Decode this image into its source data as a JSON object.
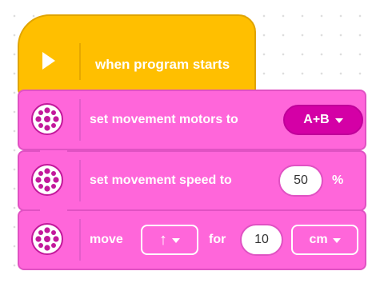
{
  "hat": {
    "label": "when program starts",
    "icon": "play-icon"
  },
  "blocks": [
    {
      "label": "set movement motors to",
      "dropdown": {
        "value": "A+B"
      },
      "icon": "motor-icon"
    },
    {
      "label": "set movement speed to",
      "input": {
        "value": "50"
      },
      "unit": "%",
      "icon": "motor-icon"
    },
    {
      "label": "move",
      "direction": {
        "icon": "arrow-up-icon",
        "glyph": "↑"
      },
      "for_label": "for",
      "input": {
        "value": "10"
      },
      "unit_dropdown": {
        "value": "cm"
      },
      "icon": "motor-icon"
    }
  ],
  "colors": {
    "event": "#ffbf00",
    "movement": "#ff66da",
    "movement_dark": "#d400a6"
  }
}
